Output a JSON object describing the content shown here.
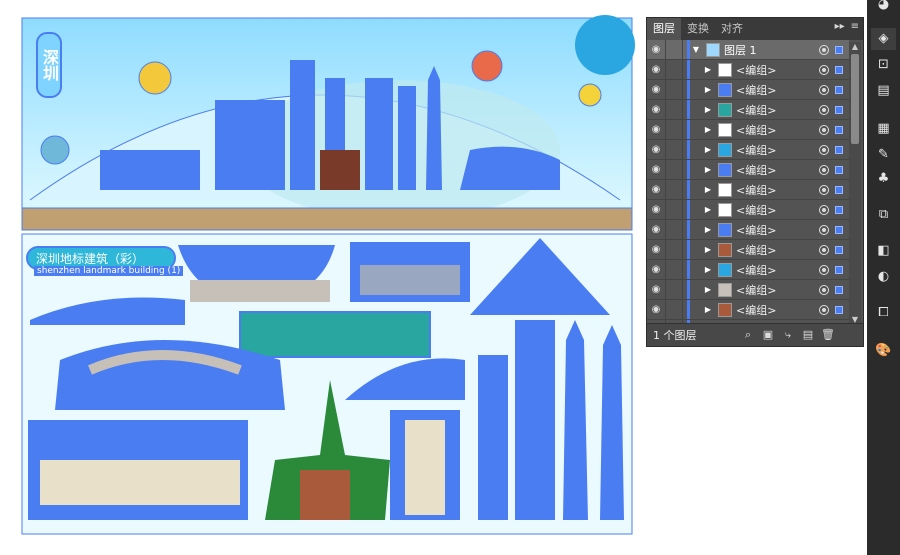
{
  "artboard": {
    "city_label": "深圳",
    "ribbon_title": "深圳地标建筑（彩）",
    "ribbon_subtitle": "shenzhen landmark building (1)"
  },
  "panel": {
    "tabs": [
      "图层",
      "变换",
      "对齐"
    ],
    "active_tab": 0,
    "top_layer": "图层 1",
    "group_label": "<编组>",
    "group_count": 14,
    "footer_text": "1 个图层"
  },
  "colors": {
    "selection": "#4a7df2",
    "sky": "#a8e6ff",
    "panel_bg": "#535353",
    "strip_bg": "#2b2b2b"
  }
}
